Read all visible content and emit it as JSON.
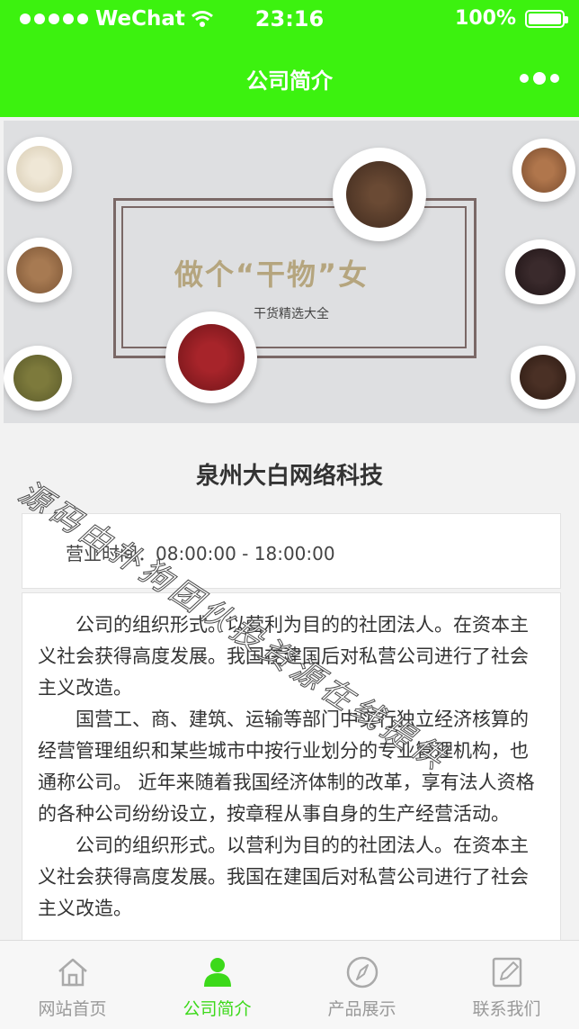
{
  "status_bar": {
    "carrier": "WeChat",
    "time": "23:16",
    "battery": "100%"
  },
  "nav": {
    "title": "公司简介"
  },
  "banner": {
    "headline": "做个“干物”女",
    "subline": "干货精选大全"
  },
  "company": {
    "name": "泉州大白网络科技",
    "hours": "营业时间：08:00:00 - 18:00:00"
  },
  "intro": {
    "paragraphs": [
      "公司的组织形式。以营利为目的的社团法人。在资本主义社会获得高度发展。我国在建国后对私营公司进行了社会主义改造。",
      "国营工、商、建筑、运输等部门中实行独立经济核算的经营管理组织和某些城市中按行业划分的专业管理机构，也通称公司。 近年来随着我国经济体制的改革，享有法人资格的各种公司纷纷设立，按章程从事自身的生产经营活动。",
      "公司的组织形式。以营利为目的的社团法人。在资本主义社会获得高度发展。我国在建国后对私营公司进行了社会主义改造。"
    ]
  },
  "watermark": "源码由扑狗团伙投资源在线提供",
  "tabbar": {
    "items": [
      {
        "label": "网站首页",
        "icon": "home-icon"
      },
      {
        "label": "公司简介",
        "icon": "person-icon"
      },
      {
        "label": "产品展示",
        "icon": "compass-icon"
      },
      {
        "label": "联系我们",
        "icon": "edit-icon"
      }
    ],
    "active_color": "#3cd91a"
  },
  "colors": {
    "brand_green": "#3cf20f"
  }
}
